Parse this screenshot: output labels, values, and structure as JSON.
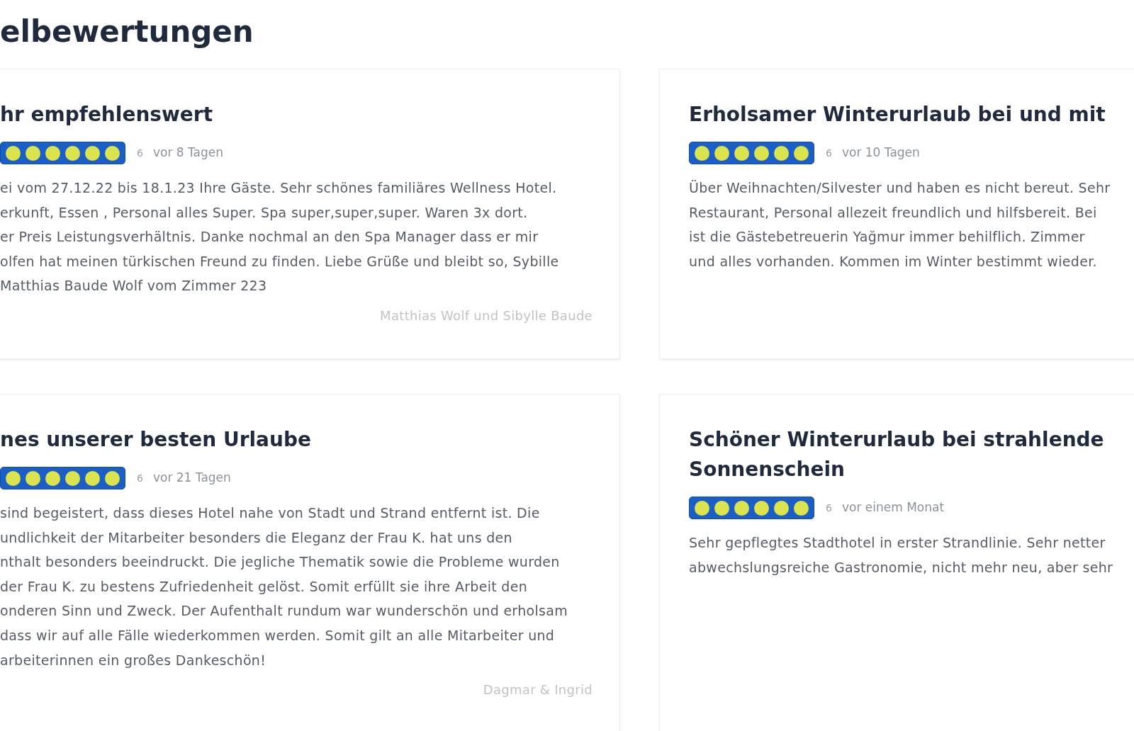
{
  "heading": "elbewertungen",
  "reviews": [
    {
      "title": "hr empfehlenswert",
      "stars": 6,
      "rating": "6",
      "date": "vor 8 Tagen",
      "text_lines": [
        "ei vom 27.12.22 bis 18.1.23 Ihre Gäste. Sehr schönes familiäres Wellness Hotel.",
        "erkunft, Essen , Personal alles Super. Spa super,super,super. Waren 3x dort.",
        "er Preis Leistungsverhältnis. Danke nochmal an den Spa Manager dass er mir",
        "olfen hat meinen türkischen Freund zu finden. Liebe Grüße und bleibt so, Sybille",
        "Matthias Baude Wolf vom Zimmer 223"
      ],
      "author": "Matthias Wolf und Sibylle Baude"
    },
    {
      "title": "Erholsamer Winterurlaub bei und mit",
      "stars": 6,
      "rating": "6",
      "date": "vor 10 Tagen",
      "text_lines": [
        "Über Weihnachten/Silvester und haben es nicht bereut. Sehr",
        "Restaurant, Personal allezeit freundlich und hilfsbereit. Bei",
        "ist die Gästebetreuerin Yağmur immer behilflich. Zimmer",
        "und alles vorhanden. Kommen im Winter bestimmt wieder."
      ]
    },
    {
      "title": "nes unserer besten Urlaube",
      "stars": 6,
      "rating": "6",
      "date": "vor 21 Tagen",
      "text_lines": [
        "sind begeistert, dass dieses Hotel nahe von Stadt und Strand entfernt ist. Die",
        "undlichkeit der Mitarbeiter besonders die Eleganz der Frau K. hat uns den",
        "nthalt besonders beeindruckt. Die jegliche Thematik sowie die Probleme wurden",
        "der Frau K. zu bestens Zufriedenheit gelöst. Somit erfüllt sie ihre Arbeit den",
        "onderen Sinn und Zweck. Der Aufenthalt rundum war wunderschön und erholsam",
        "dass wir auf alle Fälle wiederkommen werden. Somit gilt an alle Mitarbeiter und",
        "arbeiterinnen ein großes Dankeschön!"
      ],
      "author": "Dagmar & Ingrid"
    },
    {
      "title": "Schöner Winterurlaub bei strahlende Sonnenschein",
      "stars": 6,
      "rating": "6",
      "date": "vor einem Monat",
      "text_lines": [
        "Sehr gepflegtes Stadthotel in erster Strandlinie. Sehr netter",
        "abwechslungsreiche Gastronomie, nicht mehr neu, aber sehr"
      ]
    }
  ]
}
